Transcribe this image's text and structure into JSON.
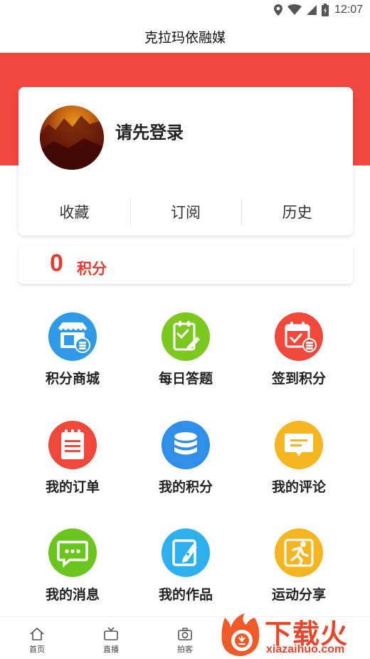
{
  "status_bar": {
    "time": "12:07"
  },
  "app": {
    "title": "克拉玛依融媒"
  },
  "profile": {
    "login_prompt": "请先登录",
    "links": [
      "收藏",
      "订阅",
      "历史"
    ]
  },
  "points": {
    "value": "0",
    "unit": "积分"
  },
  "menu": [
    {
      "label": "积分商城",
      "icon": "points-mall-icon",
      "color": "#2f9be8"
    },
    {
      "label": "每日答题",
      "icon": "daily-quiz-icon",
      "color": "#7cc820"
    },
    {
      "label": "签到积分",
      "icon": "checkin-points-icon",
      "color": "#f0483a"
    },
    {
      "label": "我的订单",
      "icon": "my-orders-icon",
      "color": "#f0483a"
    },
    {
      "label": "我的积分",
      "icon": "my-points-icon",
      "color": "#2f8ee8"
    },
    {
      "label": "我的评论",
      "icon": "my-comments-icon",
      "color": "#f5b520"
    },
    {
      "label": "我的消息",
      "icon": "my-messages-icon",
      "color": "#6cc51e"
    },
    {
      "label": "我的作品",
      "icon": "my-works-icon",
      "color": "#2fb0ee"
    },
    {
      "label": "运动分享",
      "icon": "sports-share-icon",
      "color": "#f5b520"
    }
  ],
  "tabs": [
    {
      "label": "首页",
      "icon": "home-icon"
    },
    {
      "label": "直播",
      "icon": "tv-icon"
    },
    {
      "label": "拍客",
      "icon": "camera-icon"
    }
  ],
  "watermark": {
    "text": "下载火",
    "url": "xiazaihuo.com"
  },
  "colors": {
    "brand_red": "#f2473f",
    "points_red": "#e63b30"
  }
}
